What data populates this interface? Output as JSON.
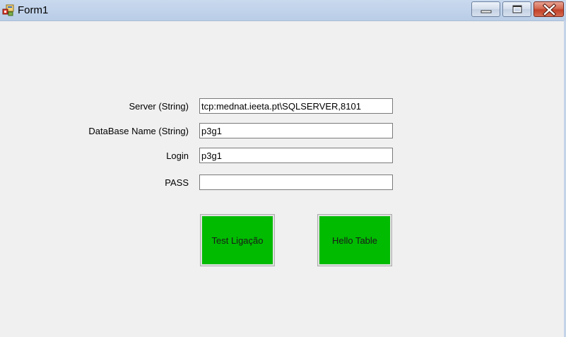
{
  "window": {
    "title": "Form1",
    "icon": "winforms-app-icon",
    "controls": {
      "minimize": "minimize-icon",
      "maximize": "maximize-icon",
      "close": "close-icon"
    }
  },
  "form": {
    "fields": [
      {
        "label": "Server (String)",
        "value": "tcp:mednat.ieeta.pt\\SQLSERVER,8101"
      },
      {
        "label": "DataBase Name (String)",
        "value": "p3g1"
      },
      {
        "label": "Login",
        "value": "p3g1"
      },
      {
        "label": "PASS",
        "value": ""
      }
    ],
    "buttons": {
      "test_label": "Test Ligação",
      "hello_label": "Hello Table"
    }
  },
  "colors": {
    "button_green": "#00bb00",
    "close_red": "#c2412a",
    "titlebar": "#c9d9ee"
  }
}
